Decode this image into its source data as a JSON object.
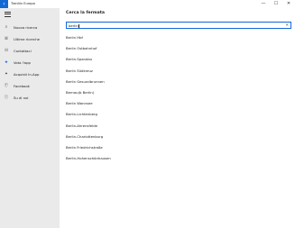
{
  "window": {
    "title": "Trenitlv Europa",
    "back": "‹",
    "minimize": "—",
    "maximize": "☐",
    "close": "✕"
  },
  "sidebar": {
    "items": [
      {
        "icon": "search-icon",
        "glyph": "⌕",
        "label": "Nuova ricerca"
      },
      {
        "icon": "history-icon",
        "glyph": "☰",
        "label": "Ultime ricerche"
      },
      {
        "icon": "contacts-icon",
        "glyph": "☷",
        "label": "Contattaci"
      },
      {
        "icon": "star-icon",
        "glyph": "★",
        "label": "Vota l'app"
      },
      {
        "icon": "shopping-icon",
        "glyph": "✦",
        "label": "Acquisti In-App"
      },
      {
        "icon": "facebook-icon",
        "glyph": "ⓕ",
        "label": "Facebook"
      },
      {
        "icon": "info-icon",
        "glyph": "ⓘ",
        "label": "Su di noi"
      }
    ]
  },
  "main": {
    "title": "Cerca la fermata",
    "search": {
      "value": "berlin",
      "clear": "✕"
    },
    "results": [
      "Berlin Hbf",
      "Berlin Ostbahnhof",
      "Berlin-Spandau",
      "Berlin Südkreuz",
      "Berlin Gesundbrunnen",
      "Bernau(b Berlin)",
      "Berlin Wannsee",
      "Berlin-Lichtenberg",
      "Berlin-Ahrensfelde",
      "Berlin-Charlottenburg",
      "Berlin Friedrichstraße",
      "Berlin-Hohenschönhausen"
    ]
  },
  "colors": {
    "accent": "#1368d6"
  }
}
